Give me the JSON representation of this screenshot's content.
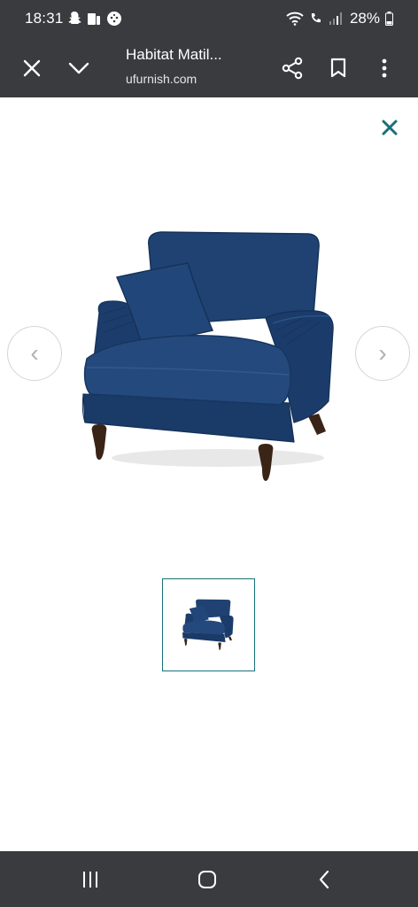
{
  "status": {
    "time": "18:31",
    "battery": "28%"
  },
  "toolbar": {
    "title": "Habitat Matil...",
    "url": "ufurnish.com"
  },
  "gallery": {
    "prev_arrow": "‹",
    "next_arrow": "›",
    "close_color": "#17707a"
  },
  "colors": {
    "bar_bg": "#3a3b3e",
    "accent": "#17707a",
    "chair_blue": "#1e3f6e"
  }
}
